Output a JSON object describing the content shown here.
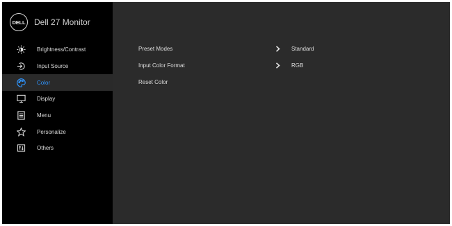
{
  "brand": {
    "logo_text": "DELL",
    "title": "Dell 27 Monitor"
  },
  "sidebar": {
    "items": [
      {
        "label": "Brightness/Contrast",
        "icon": "brightness-icon"
      },
      {
        "label": "Input Source",
        "icon": "input-source-icon"
      },
      {
        "label": "Color",
        "icon": "color-palette-icon",
        "active": true
      },
      {
        "label": "Display",
        "icon": "display-icon"
      },
      {
        "label": "Menu",
        "icon": "menu-icon"
      },
      {
        "label": "Personalize",
        "icon": "star-icon"
      },
      {
        "label": "Others",
        "icon": "others-icon"
      }
    ]
  },
  "color_panel": {
    "rows": [
      {
        "label": "Preset Modes",
        "value": "Standard"
      },
      {
        "label": "Input Color Format",
        "value": "RGB"
      },
      {
        "label": "Reset Color",
        "value": ""
      }
    ]
  },
  "colors": {
    "accent": "#2f95ff",
    "sidebar_bg": "#000000",
    "panel_bg": "#2b2b2b",
    "active_bg": "#2a2a2a",
    "text": "#dcdcdc"
  }
}
